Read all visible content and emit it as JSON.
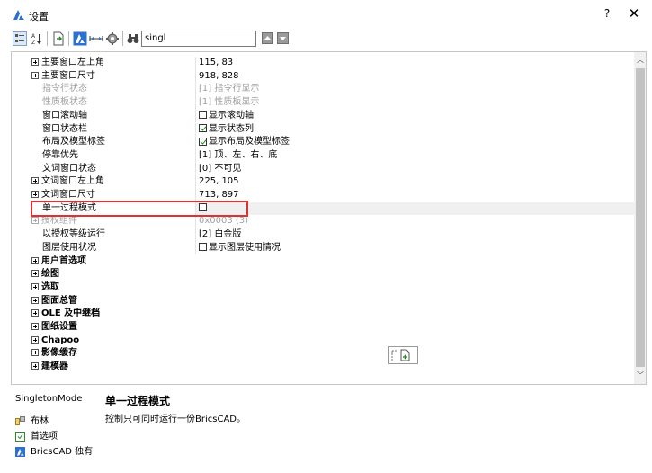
{
  "window": {
    "title": "设置",
    "help": "?",
    "close": "✕"
  },
  "toolbar": {
    "search_value": "singl"
  },
  "rows": [
    {
      "kind": "child",
      "expander": true,
      "name": "主要窗口左上角",
      "value": "115, 83"
    },
    {
      "kind": "child",
      "expander": true,
      "name": "主要窗口尺寸",
      "value": "918, 828"
    },
    {
      "kind": "grey",
      "name": "指令行状态",
      "value": "[1] 指令行显示"
    },
    {
      "kind": "grey",
      "name": "性质板状态",
      "value": "[1] 性质板显示"
    },
    {
      "kind": "child",
      "name": "窗口滚动轴",
      "checkbox": false,
      "value": "显示滚动轴"
    },
    {
      "kind": "child",
      "name": "窗口状态栏",
      "checkbox": true,
      "value": "显示状态列"
    },
    {
      "kind": "child",
      "name": "布局及模型标签",
      "checkbox": true,
      "value": "显示布局及模型标签"
    },
    {
      "kind": "child",
      "name": "停靠优先",
      "value": "[1] 顶、左、右、底"
    },
    {
      "kind": "child",
      "name": "文词窗口状态",
      "value": "[0] 不可见"
    },
    {
      "kind": "child",
      "expander": true,
      "name": "文词窗口左上角",
      "value": "225, 105"
    },
    {
      "kind": "child",
      "expander": true,
      "name": "文词窗口尺寸",
      "value": "713, 897"
    },
    {
      "kind": "selected",
      "name": "单一过程模式",
      "checkbox": false,
      "value": ""
    },
    {
      "kind": "grey",
      "expander": true,
      "name": "授权组件",
      "value": "0x0003 (3)"
    },
    {
      "kind": "child",
      "name": "以授权等级运行",
      "value": "[2] 白金版"
    },
    {
      "kind": "child",
      "name": "图层使用状况",
      "checkbox": false,
      "value": "显示图层使用情况"
    },
    {
      "kind": "section",
      "name": "用户首选项"
    },
    {
      "kind": "section",
      "name": "绘图"
    },
    {
      "kind": "section",
      "name": "选取"
    },
    {
      "kind": "section",
      "name": "图面总管"
    },
    {
      "kind": "section",
      "name": "OLE 及中继档"
    },
    {
      "kind": "section",
      "name": "图纸设置"
    },
    {
      "kind": "section",
      "name": "Chapoo"
    },
    {
      "kind": "section",
      "name": "影像缓存"
    },
    {
      "kind": "section",
      "name": "建模器"
    }
  ],
  "info": {
    "variable": "SingletonMode",
    "title": "单一过程模式",
    "description": "控制只可同时运行一份BricsCAD。",
    "lines": [
      "布林",
      "首选项",
      "BricsCAD 独有"
    ]
  },
  "colors": {
    "accent": "#2b6fd0",
    "highlight": "#e0302f"
  }
}
